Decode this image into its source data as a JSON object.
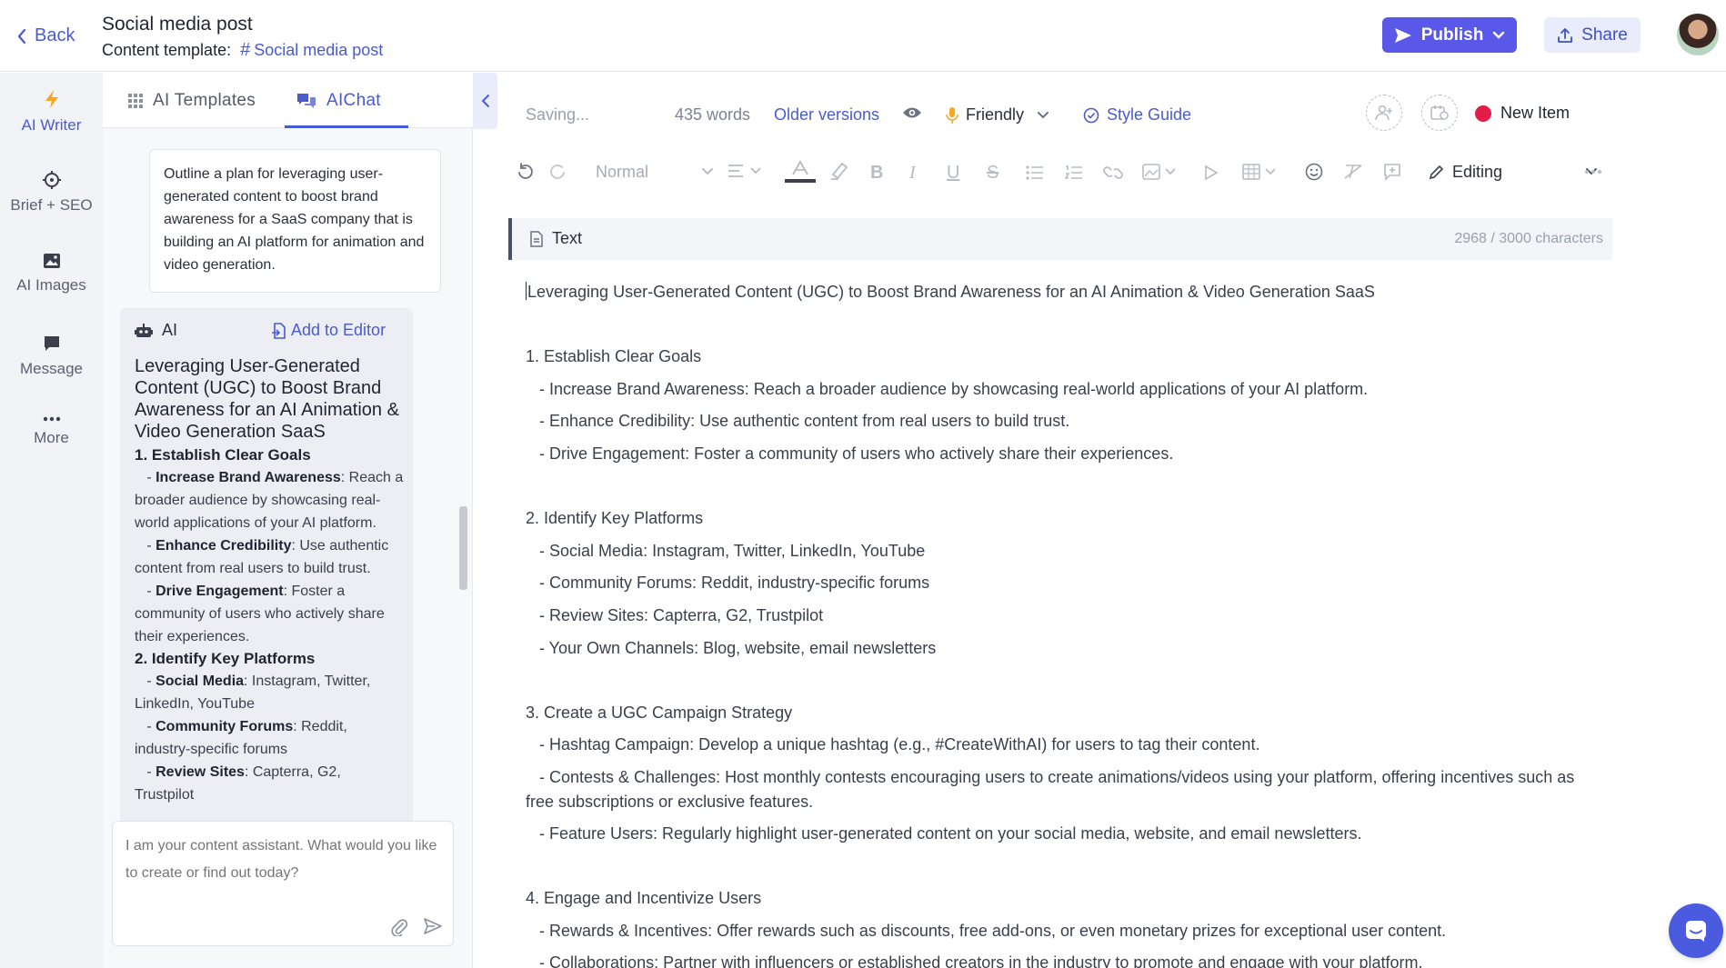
{
  "header": {
    "back_label": "Back",
    "doc_title": "Social media post",
    "template_label": "Content template:",
    "template_link": "Social media post",
    "publish_label": "Publish",
    "share_label": "Share"
  },
  "rail": {
    "items": [
      {
        "label": "AI Writer",
        "icon": "lightning-icon"
      },
      {
        "label": "Brief + SEO",
        "icon": "crosshair-icon"
      },
      {
        "label": "AI Images",
        "icon": "image-icon"
      },
      {
        "label": "Message",
        "icon": "message-icon"
      },
      {
        "label": "More",
        "icon": "more-icon"
      }
    ]
  },
  "panel": {
    "tabs": [
      {
        "label": "AI Templates",
        "icon": "grid-icon"
      },
      {
        "label": "AIChat",
        "icon": "chat-icon"
      }
    ],
    "user_message": "Outline a plan for leveraging user-generated content to boost brand awareness for a SaaS company that is building an AI platform for animation and video generation.",
    "ai": {
      "sender": "AI",
      "add_to_editor": "Add to Editor",
      "heading": "Leveraging User-Generated Content (UGC) to Boost Brand Awareness for an AI Animation & Video Generation SaaS",
      "sections": [
        {
          "title": "1. Establish Clear Goals",
          "points": [
            {
              "bold": "Increase Brand Awareness",
              "text": ": Reach a broader audience by showcasing real-world applications of your AI platform."
            },
            {
              "bold": "Enhance Credibility",
              "text": ": Use authentic content from real users to build trust."
            },
            {
              "bold": "Drive Engagement",
              "text": ": Foster a community of users who actively share their experiences."
            }
          ]
        },
        {
          "title": "2. Identify Key Platforms",
          "points": [
            {
              "bold": "Social Media",
              "text": ": Instagram, Twitter, LinkedIn, YouTube"
            },
            {
              "bold": "Community Forums",
              "text": ": Reddit, industry-specific forums"
            },
            {
              "bold": "Review Sites",
              "text": ": Capterra, G2, Trustpilot"
            }
          ]
        }
      ]
    },
    "input_placeholder": "I am your content assistant. What would you like to create or find out today?"
  },
  "editor": {
    "status": "Saving...",
    "word_count": "435 words",
    "older_versions": "Older versions",
    "tone": "Friendly",
    "style_guide": "Style Guide",
    "new_item": "New Item",
    "paragraph_style": "Normal",
    "mode": "Editing",
    "block_label": "Text",
    "char_count": "2968 / 3000 characters",
    "lines": [
      "Leveraging User-Generated Content (UGC) to Boost Brand Awareness for an AI Animation & Video Generation SaaS",
      "",
      "1. Establish Clear Goals",
      "   - Increase Brand Awareness: Reach a broader audience by showcasing real-world applications of your AI platform.",
      "   - Enhance Credibility: Use authentic content from real users to build trust.",
      "   - Drive Engagement: Foster a community of users who actively share their experiences.",
      "",
      "2. Identify Key Platforms",
      "   - Social Media: Instagram, Twitter, LinkedIn, YouTube",
      "   - Community Forums: Reddit, industry-specific forums",
      "   - Review Sites: Capterra, G2, Trustpilot",
      "   - Your Own Channels: Blog, website, email newsletters",
      "",
      "3. Create a UGC Campaign Strategy",
      "   - Hashtag Campaign: Develop a unique hashtag (e.g., #CreateWithAI) for users to tag their content.",
      "   - Contests & Challenges: Host monthly contests encouraging users to create animations/videos using your platform, offering incentives such as free subscriptions or exclusive features.",
      "   - Feature Users: Regularly highlight user-generated content on your social media, website, and email newsletters.",
      "",
      "4. Engage and Incentivize Users",
      "   - Rewards & Incentives: Offer rewards such as discounts, free add-ons, or even monetary prizes for exceptional user content.",
      "   - Collaborations: Partner with influencers or established creators in the industry to promote and engage with your platform."
    ]
  },
  "colors": {
    "accent": "#5a58e8",
    "link": "#4a5bd0",
    "status_dot": "#e11d48"
  }
}
